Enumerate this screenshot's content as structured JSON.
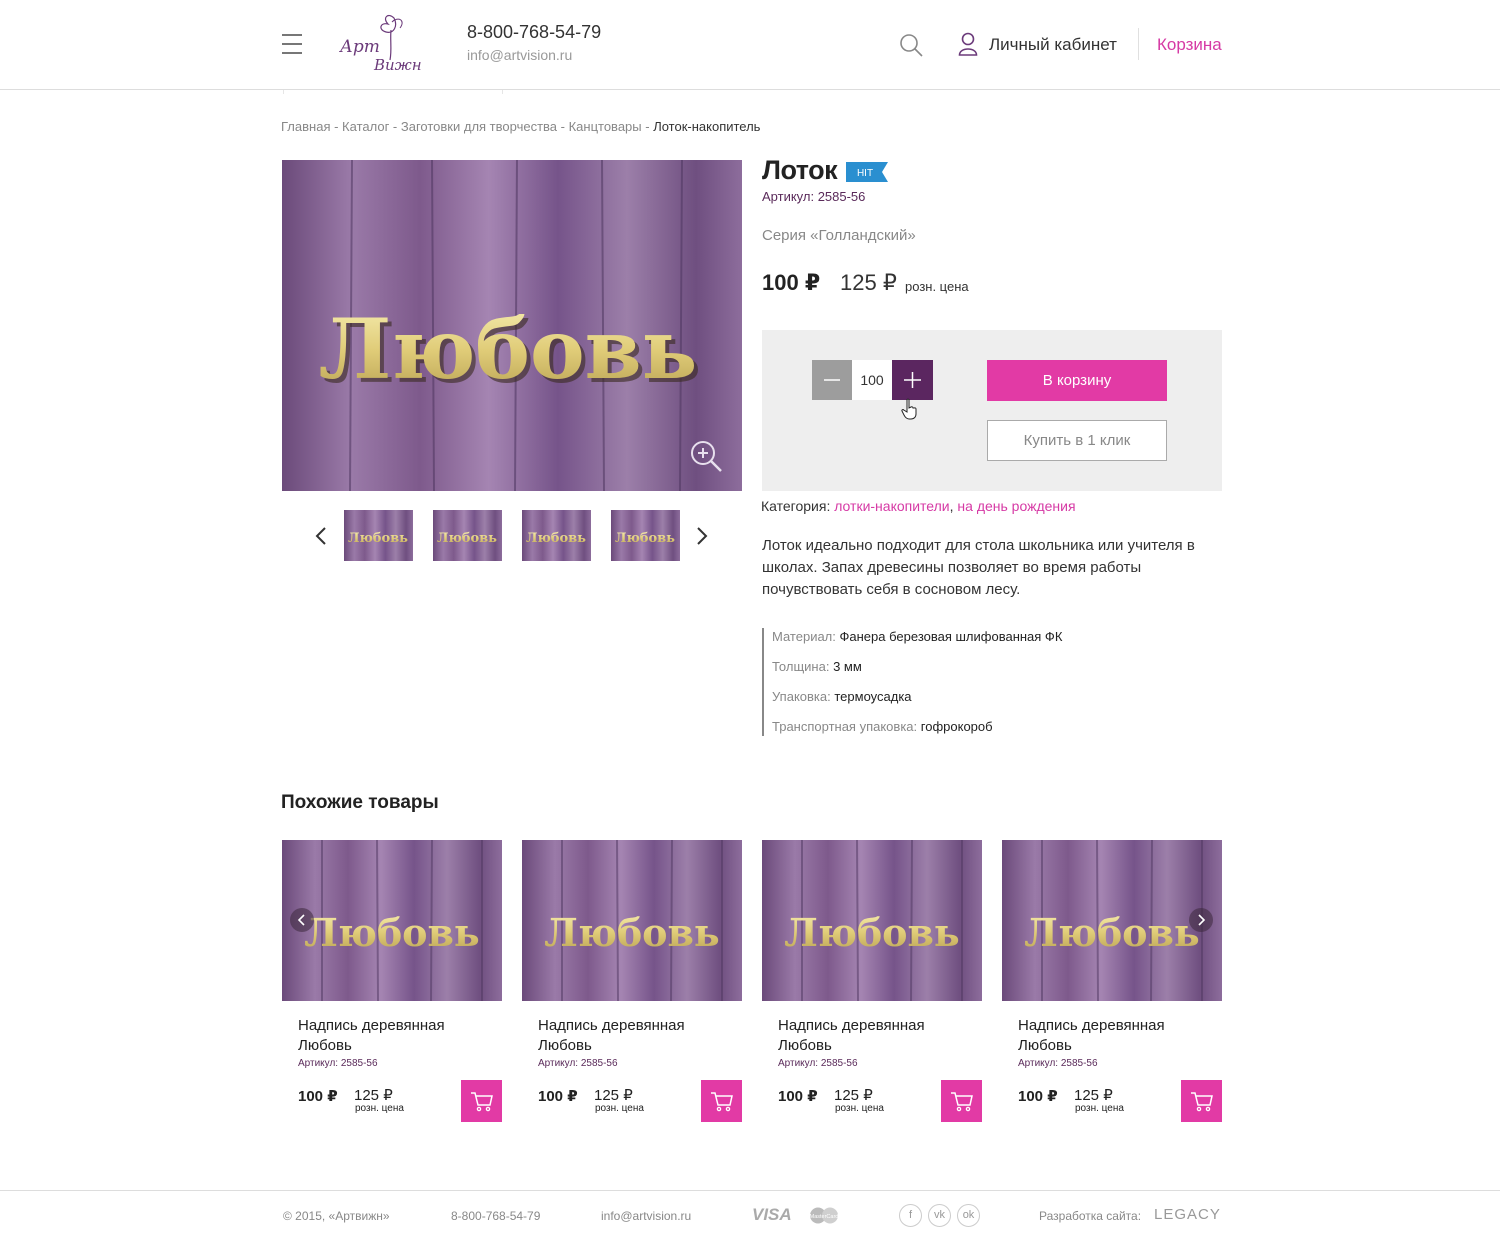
{
  "header": {
    "phone": "8-800-768-54-79",
    "email": "info@artvision.ru",
    "account_label": "Личный кабинет",
    "cart_label": "Корзина",
    "logo_text_1": "Арт",
    "logo_text_2": "Вижн"
  },
  "breadcrumb": {
    "items": [
      "Главная",
      "Каталог",
      "Заготовки для творчества",
      "Канцтовары"
    ],
    "separator": " - ",
    "current": "Лоток-накопитель"
  },
  "product": {
    "image_text": "Любовь",
    "title": "Лоток",
    "badge": "HIT",
    "article": "Артикул: 2585-56",
    "series": "Серия «Голландский»",
    "price": "100 ₽",
    "old_price": "125 ₽",
    "retail_label": "розн. цена",
    "quantity": "100",
    "add_to_cart": "В корзину",
    "buy_one_click": "Купить в 1 клик",
    "category_label": "Категория:",
    "categories": [
      "лотки-накопители",
      "на день рождения"
    ],
    "description": "Лоток идеально подходит для стола школьника или учителя в школах. Запах древесины позволяет во время работы почувствовать себя в сосновом лесу.",
    "specs": [
      {
        "label": "Материал:",
        "value": "Фанера березовая шлифованная ФК"
      },
      {
        "label": "Толщина:",
        "value": "3 мм"
      },
      {
        "label": "Упаковка:",
        "value": "термоусадка"
      },
      {
        "label": "Транспортная упаковка:",
        "value": "гофрокороб"
      }
    ]
  },
  "similar": {
    "title": "Похожие товары",
    "items": [
      {
        "name": "Надпись деревянная Любовь",
        "article": "Артикул: 2585-56",
        "price": "100 ₽",
        "old_price": "125 ₽",
        "retail_label": "розн. цена"
      },
      {
        "name": "Надпись деревянная Любовь",
        "article": "Артикул: 2585-56",
        "price": "100 ₽",
        "old_price": "125 ₽",
        "retail_label": "розн. цена"
      },
      {
        "name": "Надпись деревянная Любовь",
        "article": "Артикул: 2585-56",
        "price": "100 ₽",
        "old_price": "125 ₽",
        "retail_label": "розн. цена"
      },
      {
        "name": "Надпись деревянная Любовь",
        "article": "Артикул: 2585-56",
        "price": "100 ₽",
        "old_price": "125 ₽",
        "retail_label": "розн. цена"
      }
    ]
  },
  "footer": {
    "copyright": "© 2015, «Артвижн»",
    "phone": "8-800-768-54-79",
    "email": "info@artvision.ru",
    "visa": "VISA",
    "mastercard": "MasterCard",
    "social": [
      "f",
      "vk",
      "ok"
    ],
    "dev_label": "Разработка сайта:",
    "dev_name": "LEGACY"
  },
  "colors": {
    "accent": "#e23aa5",
    "brand_purple": "#5b2660",
    "badge_blue": "#2a8fd0"
  }
}
